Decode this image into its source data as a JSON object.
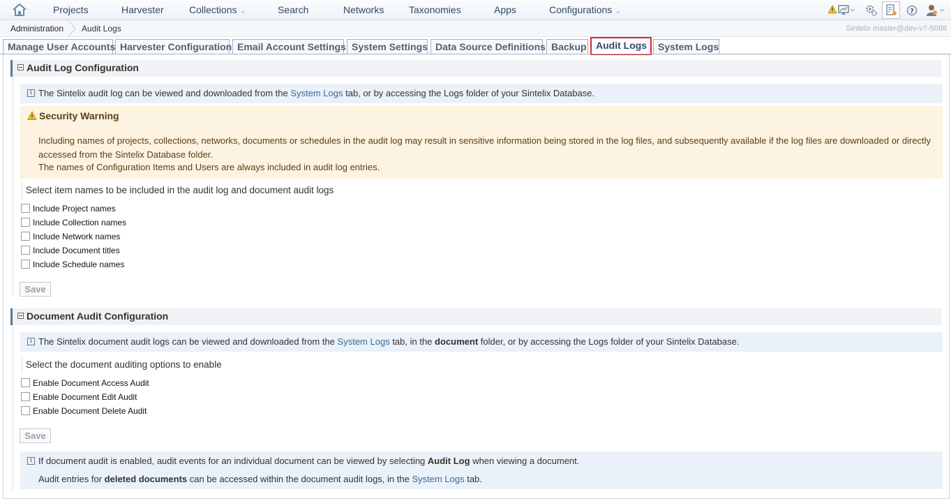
{
  "nav": {
    "items": [
      {
        "label": "Projects"
      },
      {
        "label": "Harvester"
      },
      {
        "label": "Collections"
      },
      {
        "label": "Search"
      },
      {
        "label": "Networks"
      },
      {
        "label": "Taxonomies"
      },
      {
        "label": "Apps"
      },
      {
        "label": "Configurations"
      }
    ],
    "icons": [
      "home-icon",
      "warning-monitor-icon",
      "settings-icon",
      "admin-icon",
      "help-icon",
      "user-icon"
    ]
  },
  "breadcrumb": {
    "root": "Administration",
    "current": "Audit Logs"
  },
  "server_info": "Sintelix master@dev-v7-5088",
  "tabs": [
    {
      "label": "Manage User Accounts"
    },
    {
      "label": "Harvester Configuration"
    },
    {
      "label": "Email Account Settings"
    },
    {
      "label": "System Settings"
    },
    {
      "label": "Data Source Definitions"
    },
    {
      "label": "Backup"
    },
    {
      "label": "Audit Logs",
      "active": true
    },
    {
      "label": "System Logs"
    }
  ],
  "audit_log": {
    "title": "Audit Log Configuration",
    "info_pre": "The Sintelix audit log can be viewed and downloaded from the ",
    "info_link": "System Logs",
    "info_post": " tab, or by accessing the Logs folder of your Sintelix Database.",
    "warning_title": "Security Warning",
    "warning_body1": "Including names of projects, collections, networks, documents or schedules in the audit log may result in sensitive information being stored in the log files, and subsequently available if the log files are downloaded or directly accessed from the Sintelix Database folder.",
    "warning_body2": "The names of Configuration Items and Users are always included in audit log entries.",
    "prompt": "Select item names to be included in the audit log and document audit logs",
    "options": [
      "Include Project names",
      "Include Collection names",
      "Include Network names",
      "Include Document titles",
      "Include Schedule names"
    ],
    "save_label": "Save"
  },
  "doc_audit": {
    "title": "Document Audit Configuration",
    "info_pre": "The Sintelix document audit logs can be viewed and downloaded from the ",
    "info_link": "System Logs",
    "info_mid": " tab, in the ",
    "info_bold": "document",
    "info_post": " folder, or by accessing the Logs folder of your Sintelix Database.",
    "prompt": "Select the document auditing options to enable",
    "options": [
      "Enable Document Access Audit",
      "Enable Document Edit Audit",
      "Enable Document Delete Audit"
    ],
    "save_label": "Save",
    "note1_pre": "If document audit is enabled, audit events for an individual document can be viewed by selecting ",
    "note1_bold": "Audit Log",
    "note1_post": " when viewing a document.",
    "note2_pre": "Audit entries for ",
    "note2_bold": "deleted documents",
    "note2_mid": " can be accessed within the document audit logs, in the ",
    "note2_link": "System Logs",
    "note2_post": " tab."
  }
}
